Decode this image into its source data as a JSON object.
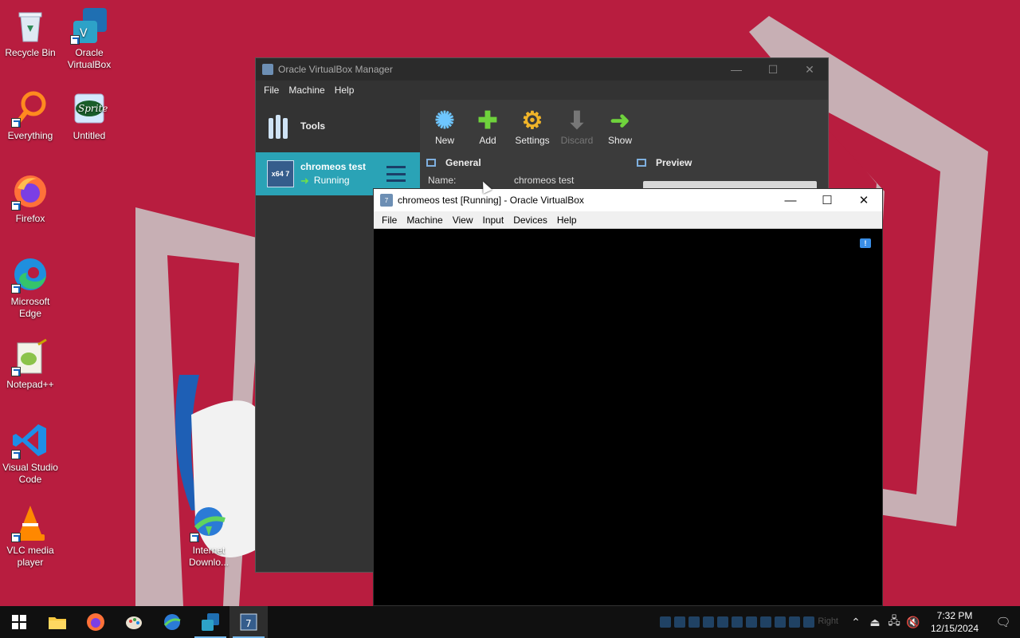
{
  "desktop": {
    "icons": [
      {
        "label": "Recycle Bin",
        "icon": "recycle-bin-icon"
      },
      {
        "label": "Oracle VirtualBox",
        "icon": "virtualbox-icon"
      },
      {
        "label": "Everything",
        "icon": "everything-search-icon"
      },
      {
        "label": "Untitled",
        "icon": "sprite-image-icon"
      },
      {
        "label": "Firefox",
        "icon": "firefox-icon"
      },
      {
        "label": "Microsoft Edge",
        "icon": "edge-icon"
      },
      {
        "label": "Notepad++",
        "icon": "notepad-plus-plus-icon"
      },
      {
        "label": "Visual Studio Code",
        "icon": "vscode-icon"
      },
      {
        "label": "VLC media player",
        "icon": "vlc-icon"
      },
      {
        "label": "Internet Downlo...",
        "icon": "internet-download-manager-icon"
      }
    ]
  },
  "manager": {
    "title": "Oracle VirtualBox Manager",
    "menu": [
      "File",
      "Machine",
      "Help"
    ],
    "tools_label": "Tools",
    "vm": {
      "name": "chromeos test",
      "state": "Running",
      "os_badge": "x64 7"
    },
    "toolbar": [
      {
        "label": "New",
        "icon": "new-icon",
        "enabled": true
      },
      {
        "label": "Add",
        "icon": "add-icon",
        "enabled": true
      },
      {
        "label": "Settings",
        "icon": "settings-gear-icon",
        "enabled": true
      },
      {
        "label": "Discard",
        "icon": "discard-arrow-icon",
        "enabled": false
      },
      {
        "label": "Show",
        "icon": "show-arrow-icon",
        "enabled": true
      }
    ],
    "general": {
      "heading": "General",
      "name_key": "Name:",
      "name_value": "chromeos test"
    },
    "preview_heading": "Preview"
  },
  "vm_window": {
    "title": "chromeos test [Running] - Oracle VirtualBox",
    "menu": [
      "File",
      "Machine",
      "View",
      "Input",
      "Devices",
      "Help"
    ]
  },
  "taskbar": {
    "apps": [
      {
        "name": "start",
        "icon": "windows-start-icon"
      },
      {
        "name": "file-explorer",
        "icon": "folder-icon"
      },
      {
        "name": "firefox",
        "icon": "firefox-icon"
      },
      {
        "name": "paint",
        "icon": "paint-icon"
      },
      {
        "name": "internet-download-manager",
        "icon": "idm-icon"
      },
      {
        "name": "virtualbox-manager",
        "icon": "virtualbox-icon"
      },
      {
        "name": "vm-window",
        "icon": "vm-os-icon"
      }
    ],
    "clock": {
      "time": "7:32 PM",
      "date": "12/15/2024"
    },
    "host_key_label": "Right"
  },
  "colors": {
    "wallpaper": "#b81d3f",
    "selection": "#2aa3b6",
    "taskbar": "#101010"
  }
}
